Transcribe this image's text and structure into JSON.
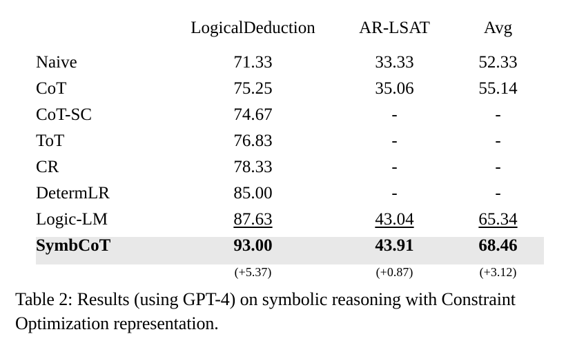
{
  "table": {
    "columns": [
      "",
      "LogicalDeduction",
      "AR-LSAT",
      "Avg"
    ],
    "rows": [
      {
        "method": "Naive",
        "logical_deduction": "71.33",
        "ar_lsat": "33.33",
        "avg": "52.33",
        "style": "normal"
      },
      {
        "method": "CoT",
        "logical_deduction": "75.25",
        "ar_lsat": "35.06",
        "avg": "55.14",
        "style": "normal"
      },
      {
        "method": "CoT-SC",
        "logical_deduction": "74.67",
        "ar_lsat": "-",
        "avg": "-",
        "style": "normal"
      },
      {
        "method": "ToT",
        "logical_deduction": "76.83",
        "ar_lsat": "-",
        "avg": "-",
        "style": "normal"
      },
      {
        "method": "CR",
        "logical_deduction": "78.33",
        "ar_lsat": "-",
        "avg": "-",
        "style": "normal"
      },
      {
        "method": "DetermLR",
        "logical_deduction": "85.00",
        "ar_lsat": "-",
        "avg": "-",
        "style": "normal"
      },
      {
        "method": "Logic-LM",
        "logical_deduction": "87.63",
        "ar_lsat": "43.04",
        "avg": "65.34",
        "style": "underline"
      },
      {
        "method": "SymbCoT",
        "logical_deduction": "93.00",
        "ar_lsat": "43.91",
        "avg": "68.46",
        "style": "highlight"
      }
    ],
    "delta_row": {
      "method": "",
      "logical_deduction": "(+5.37)",
      "ar_lsat": "(+0.87)",
      "avg": "(+3.12)"
    },
    "highlight_color": "#e8e8e8",
    "rule_color": "#000000"
  },
  "caption": {
    "text": "Table 2: Results (using GPT-4) on symbolic reasoning with Constraint Optimization representation."
  }
}
